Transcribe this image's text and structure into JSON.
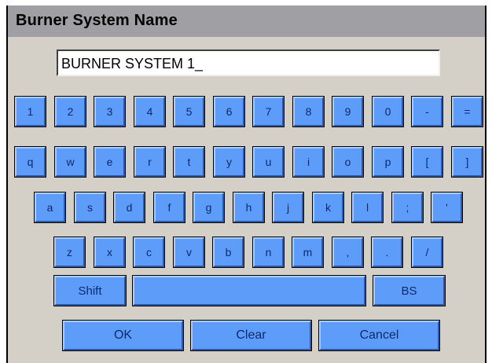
{
  "dialog": {
    "title": "Burner System Name",
    "name_value": "BURNER SYSTEM 1_"
  },
  "keyboard": {
    "row1": [
      "1",
      "2",
      "3",
      "4",
      "5",
      "6",
      "7",
      "8",
      "9",
      "0",
      "-",
      "="
    ],
    "row2": [
      "q",
      "w",
      "e",
      "r",
      "t",
      "y",
      "u",
      "i",
      "o",
      "p",
      "[",
      "]"
    ],
    "row3": [
      "a",
      "s",
      "d",
      "f",
      "g",
      "h",
      "j",
      "k",
      "l",
      ";",
      "'"
    ],
    "row4": [
      "z",
      "x",
      "c",
      "v",
      "b",
      "n",
      "m",
      ",",
      ".",
      "/"
    ],
    "shift_label": "Shift",
    "space_label": "",
    "backspace_label": "BS"
  },
  "actions": {
    "ok_label": "OK",
    "clear_label": "Clear",
    "cancel_label": "Cancel"
  },
  "colors": {
    "key_face": "#5e9cfa",
    "key_text": "#0e2a6c",
    "dialog_bg": "#d4d0c8",
    "titlebar_bg": "#a0a0a4"
  }
}
